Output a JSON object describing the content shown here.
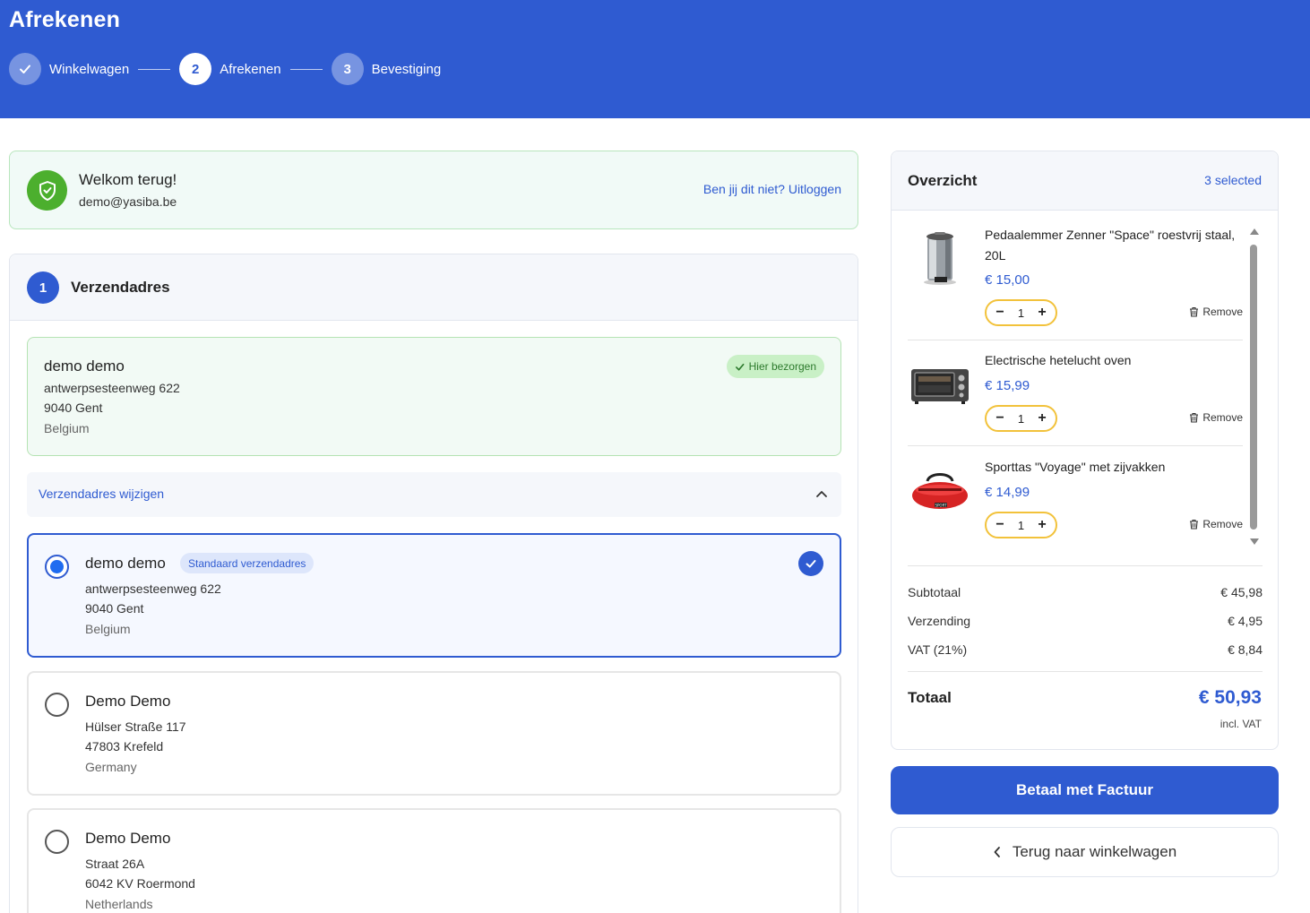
{
  "header": {
    "title": "Afrekenen",
    "steps": [
      {
        "number": "",
        "label": "Winkelwagen",
        "state": "done"
      },
      {
        "number": "2",
        "label": "Afrekenen",
        "state": "active"
      },
      {
        "number": "3",
        "label": "Bevestiging",
        "state": "todo"
      }
    ]
  },
  "welcome": {
    "title": "Welkom terug!",
    "email": "demo@yasiba.be",
    "logout_link": "Ben jij dit niet? Uitloggen"
  },
  "shipping": {
    "step_number": "1",
    "title": "Verzendadres",
    "current": {
      "name": "demo demo",
      "street": "antwerpsesteenweg 622",
      "city": "9040 Gent",
      "country": "Belgium",
      "badge": "Hier bezorgen"
    },
    "change_label": "Verzendadres wijzigen",
    "options": [
      {
        "name": "demo demo",
        "badge": "Standaard verzendadres",
        "street": "antwerpsesteenweg 622",
        "city": "9040 Gent",
        "country": "Belgium",
        "selected": true
      },
      {
        "name": "Demo Demo",
        "street": "Hülser Straße 117",
        "city": "47803 Krefeld",
        "country": "Germany",
        "selected": false
      },
      {
        "name": "Demo Demo",
        "street": "Straat 26A",
        "city": "6042 KV Roermond",
        "country": "Netherlands",
        "selected": false
      }
    ]
  },
  "overview": {
    "title": "Overzicht",
    "selected_count": "3 selected",
    "items": [
      {
        "name": "Pedaalemmer Zenner \"Space\" roestvrij staal, 20L",
        "price": "€ 15,00",
        "qty": "1",
        "remove": "Remove",
        "icon": "trash-bin-image"
      },
      {
        "name": "Electrische hetelucht oven",
        "price": "€ 15,99",
        "qty": "1",
        "remove": "Remove",
        "icon": "oven-image"
      },
      {
        "name": "Sporttas \"Voyage\" met zijvakken",
        "price": "€ 14,99",
        "qty": "1",
        "remove": "Remove",
        "icon": "sports-bag-image"
      }
    ],
    "subtotal_label": "Subtotaal",
    "subtotal_value": "€ 45,98",
    "shipping_label": "Verzending",
    "shipping_value": "€ 4,95",
    "vat_label": "VAT (21%)",
    "vat_value": "€ 8,84",
    "total_label": "Totaal",
    "total_value": "€ 50,93",
    "total_note": "incl. VAT"
  },
  "actions": {
    "pay_label": "Betaal met Factuur",
    "back_label": "Terug naar winkelwagen"
  },
  "colors": {
    "brand": "#2f5bd1",
    "success": "#4caf2e",
    "qty_border": "#f2c23b"
  }
}
